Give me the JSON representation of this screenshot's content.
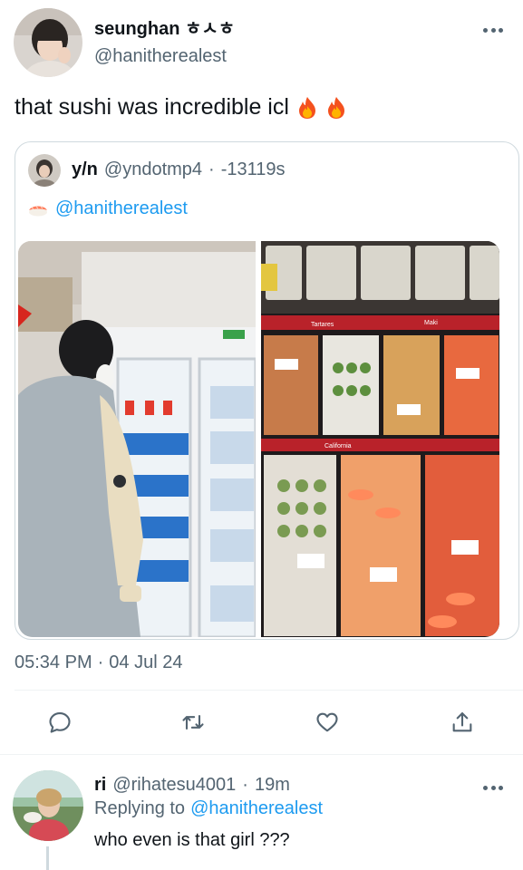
{
  "main_tweet": {
    "author": {
      "display_name": "seunghan ㅎㅅㅎ",
      "handle": "@hanitherealest"
    },
    "text": "that sushi was incredible icl",
    "emojis": [
      "fire",
      "fire"
    ],
    "quoted_tweet": {
      "display_name": "y/n",
      "handle": "@yndotmp4",
      "separator": "·",
      "time": "-13119s",
      "emoji": "sushi",
      "mention": "@hanitherealest",
      "photos": [
        {
          "description": "person in a varsity jacket at a convenience store fridge with water bottles"
        },
        {
          "description": "supermarket display case full of packaged sushi"
        }
      ],
      "labels": [
        "Tartares",
        "Maki",
        "California"
      ]
    },
    "timestamp": {
      "time": "05:34 PM",
      "separator": "·",
      "date": "04 Jul 24"
    },
    "actions": [
      {
        "name": "reply",
        "icon": "reply-icon"
      },
      {
        "name": "retweet",
        "icon": "retweet-icon"
      },
      {
        "name": "like",
        "icon": "heart-icon"
      },
      {
        "name": "share",
        "icon": "share-icon"
      }
    ]
  },
  "reply": {
    "display_name": "ri",
    "handle": "@rihatesu4001",
    "separator": "·",
    "time": "19m",
    "replying_label": "Replying to",
    "replying_to": "@hanitherealest",
    "text": "who even is that girl ???"
  },
  "colors": {
    "text_primary": "#0f1419",
    "text_secondary": "#536471",
    "link": "#1d9bf0",
    "border": "#cfd9de",
    "divider": "#eff3f4"
  }
}
